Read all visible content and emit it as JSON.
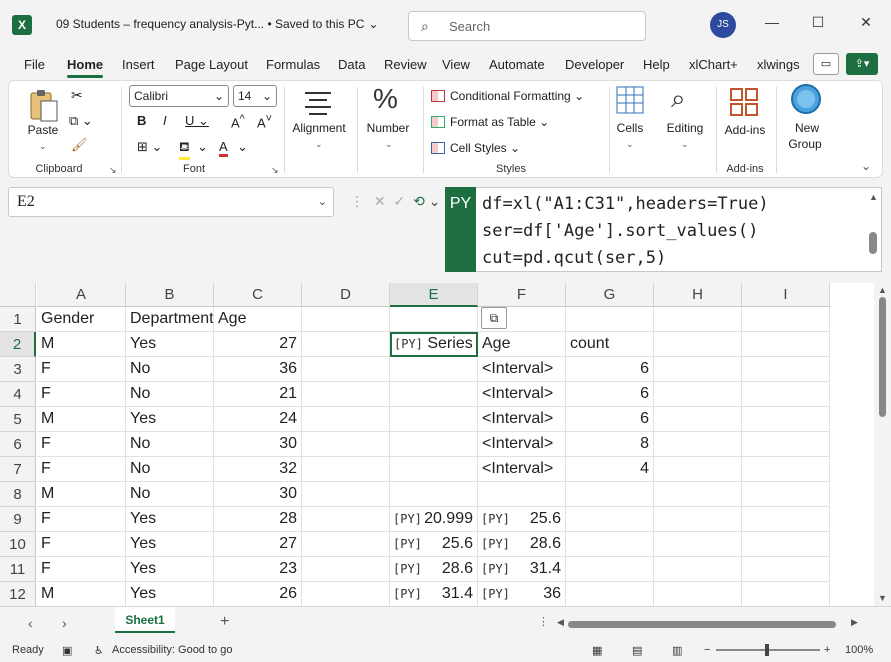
{
  "window": {
    "title": "09 Students – frequency analysis-Pyt...  •  Saved to this PC",
    "search_placeholder": "Search",
    "user_initials": "JS"
  },
  "menu": [
    "File",
    "Home",
    "Insert",
    "Page Layout",
    "Formulas",
    "Data",
    "Review",
    "View",
    "Automate",
    "Developer",
    "Help",
    "xlChart+",
    "xlwings"
  ],
  "active_menu": "Home",
  "ribbon": {
    "clipboard": {
      "paste": "Paste",
      "label": "Clipboard"
    },
    "font": {
      "name": "Calibri",
      "size": "14",
      "label": "Font"
    },
    "alignment": "Alignment",
    "number": "Number",
    "styles": {
      "conditional_formatting": "Conditional Formatting",
      "format_as_table": "Format as Table",
      "cell_styles": "Cell Styles",
      "label": "Styles"
    },
    "cells": "Cells",
    "editing": "Editing",
    "addins": {
      "button": "Add-ins",
      "label": "Add-ins"
    },
    "new_group": {
      "line1": "New",
      "line2": "Group"
    }
  },
  "formula_bar": {
    "name_box": "E2",
    "badge": "PY",
    "lines": [
      "df=xl(\"A1:C31\",headers=True)",
      "ser=df['Age'].sort_values()",
      "cut=pd.qcut(ser,5)"
    ]
  },
  "grid": {
    "columns": [
      "A",
      "B",
      "C",
      "D",
      "E",
      "F",
      "G",
      "H",
      "I"
    ],
    "active_column": "E",
    "active_row": "2",
    "rows": [
      {
        "n": "1",
        "A": "Gender",
        "B": "Department",
        "C": "Age",
        "D": "",
        "E": "",
        "F": "",
        "G": ""
      },
      {
        "n": "2",
        "A": "M",
        "B": "Yes",
        "C": "27",
        "D": "",
        "E": "Series",
        "F": "Age",
        "G": "count"
      },
      {
        "n": "3",
        "A": "F",
        "B": "No",
        "C": "36",
        "D": "",
        "E": "",
        "F": "<Interval>",
        "G": "6"
      },
      {
        "n": "4",
        "A": "F",
        "B": "No",
        "C": "21",
        "D": "",
        "E": "",
        "F": "<Interval>",
        "G": "6"
      },
      {
        "n": "5",
        "A": "M",
        "B": "Yes",
        "C": "24",
        "D": "",
        "E": "",
        "F": "<Interval>",
        "G": "6"
      },
      {
        "n": "6",
        "A": "F",
        "B": "No",
        "C": "30",
        "D": "",
        "E": "",
        "F": "<Interval>",
        "G": "8"
      },
      {
        "n": "7",
        "A": "F",
        "B": "No",
        "C": "32",
        "D": "",
        "E": "",
        "F": "<Interval>",
        "G": "4"
      },
      {
        "n": "8",
        "A": "M",
        "B": "No",
        "C": "30",
        "D": "",
        "E": "",
        "F": "",
        "G": ""
      },
      {
        "n": "9",
        "A": "F",
        "B": "Yes",
        "C": "28",
        "D": "",
        "E": "20.999",
        "F": "25.6",
        "G": ""
      },
      {
        "n": "10",
        "A": "F",
        "B": "Yes",
        "C": "27",
        "D": "",
        "E": "25.6",
        "F": "28.6",
        "G": ""
      },
      {
        "n": "11",
        "A": "F",
        "B": "Yes",
        "C": "23",
        "D": "",
        "E": "28.6",
        "F": "31.4",
        "G": ""
      },
      {
        "n": "12",
        "A": "M",
        "B": "Yes",
        "C": "26",
        "D": "",
        "E": "31.4",
        "F": "36",
        "G": ""
      }
    ],
    "py_icon": "[PY]"
  },
  "sheet_tab": "Sheet1",
  "status": {
    "ready": "Ready",
    "accessibility": "Accessibility: Good to go",
    "zoom": "100%"
  }
}
